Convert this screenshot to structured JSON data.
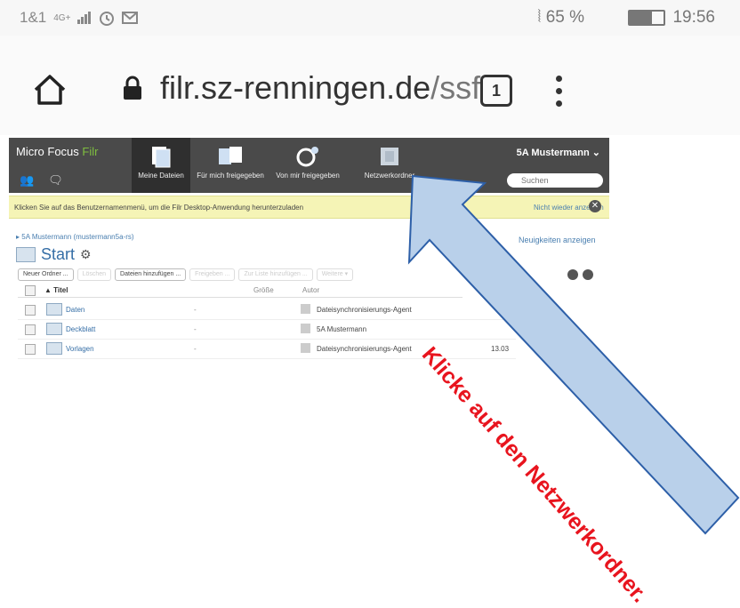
{
  "status_bar": {
    "carrier": "1&1",
    "network": "4G+",
    "battery_text": "65 %",
    "battery_level": 0.65,
    "time": "19:56"
  },
  "browser": {
    "url_host": "filr.sz-renningen.de",
    "url_path": "/ssf",
    "tab_count": "1"
  },
  "filr": {
    "logo_main": "Micro Focus",
    "logo_sub": "Filr",
    "nav": [
      {
        "label": "Meine Dateien"
      },
      {
        "label": "Für mich freigegeben"
      },
      {
        "label": "Von mir freigegeben"
      },
      {
        "label": "Netzwerkordner"
      }
    ],
    "user_name": "5A Mustermann",
    "search_placeholder": "Suchen",
    "notification": {
      "message": "Klicken Sie auf das Benutzernamenmenü, um die Filr Desktop-Anwendung herunterzuladen",
      "dismiss": "Nicht wieder anzeigen"
    },
    "breadcrumb": "5A Mustermann (mustermann5a-rs)",
    "news_link": "Neuigkeiten anzeigen",
    "page_title": "Start",
    "toolbar": [
      {
        "label": "Neuer Ordner ..."
      },
      {
        "label": "Löschen"
      },
      {
        "label": "Dateien hinzufügen ..."
      },
      {
        "label": "Freigeben ..."
      },
      {
        "label": "Zur Liste hinzufügen ..."
      },
      {
        "label": "Weitere ▾"
      }
    ],
    "table": {
      "col_title": "Titel",
      "col_size": "Größe",
      "col_author": "Autor",
      "rows": [
        {
          "name": "Daten",
          "size": "-",
          "author": "Dateisynchronisierungs-Agent",
          "date": ""
        },
        {
          "name": "Deckblatt",
          "size": "-",
          "author": "5A Mustermann",
          "date": ""
        },
        {
          "name": "Vorlagen",
          "size": "-",
          "author": "Dateisynchronisierungs-Agent",
          "date": "13.03"
        }
      ]
    }
  },
  "annotation": {
    "text": "Klicke auf den Netzwerkordner.",
    "arrow_color": "#b9d0ea",
    "text_color": "#e8141e"
  }
}
